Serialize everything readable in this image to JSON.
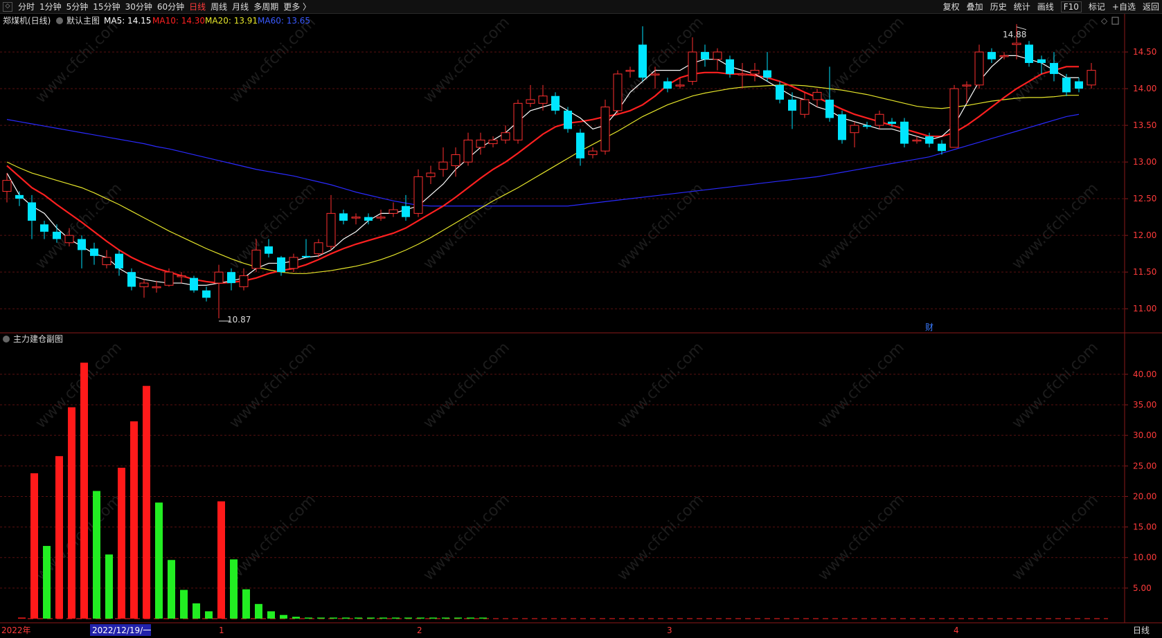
{
  "toolbar": {
    "left_items": [
      "分时",
      "1分钟",
      "5分钟",
      "15分钟",
      "30分钟",
      "60分钟",
      "日线",
      "周线",
      "月线",
      "多周期",
      "更多 〉"
    ],
    "active_item": "日线",
    "right_items": [
      "复权",
      "叠加",
      "历史",
      "统计",
      "画线",
      "F10",
      "标记",
      "+自选",
      "返回"
    ]
  },
  "main_chart": {
    "stock_title": "郑煤机(日线)",
    "template_label": "默认主图",
    "ma5_label": "MA5: 14.15",
    "ma10_label": "MA10: 14.30",
    "ma20_label": "MA20: 13.91",
    "ma60_label": "MA60: 13.65",
    "high_marker": "14.88",
    "low_marker": "10.87",
    "finance_marker": "财",
    "colors": {
      "up": "#ff3030",
      "down": "#00e5ff",
      "ma5": "#ffffff",
      "ma10": "#ff2020",
      "ma20": "#e6e62a",
      "ma60": "#2a2aff"
    }
  },
  "sub_chart": {
    "title": "主力建仓副图"
  },
  "x_axis": {
    "labels": [
      "2022年",
      "1",
      "2",
      "3",
      "4"
    ],
    "cursor_label": "2022/12/19/一",
    "period_label": "日线"
  },
  "watermark": "www.cfchi.com",
  "chart_data": [
    {
      "type": "candlestick",
      "title": "郑煤机(日线)",
      "ylim": [
        10.7,
        14.85
      ],
      "y_ticks": [
        "14.50",
        "14.00",
        "13.50",
        "13.00",
        "12.50",
        "12.00",
        "11.50",
        "11.00"
      ],
      "candles": [
        [
          12.6,
          12.75,
          12.85,
          12.45
        ],
        [
          12.55,
          12.5,
          12.6,
          12.4
        ],
        [
          12.45,
          12.2,
          12.55,
          11.95
        ],
        [
          12.15,
          12.05,
          12.2,
          11.95
        ],
        [
          12.05,
          11.95,
          12.15,
          11.9
        ],
        [
          11.9,
          12.0,
          12.1,
          11.85
        ],
        [
          11.95,
          11.8,
          12.0,
          11.55
        ],
        [
          11.82,
          11.72,
          11.9,
          11.6
        ],
        [
          11.6,
          11.7,
          11.8,
          11.55
        ],
        [
          11.75,
          11.55,
          11.8,
          11.45
        ],
        [
          11.5,
          11.3,
          11.55,
          11.25
        ],
        [
          11.3,
          11.35,
          11.4,
          11.15
        ],
        [
          11.3,
          11.3,
          11.38,
          11.22
        ],
        [
          11.32,
          11.5,
          11.55,
          11.3
        ],
        [
          11.45,
          11.45,
          11.5,
          11.35
        ],
        [
          11.42,
          11.25,
          11.45,
          11.22
        ],
        [
          11.25,
          11.15,
          11.3,
          11.1
        ],
        [
          11.35,
          11.5,
          11.6,
          10.87
        ],
        [
          11.5,
          11.35,
          11.55,
          11.25
        ],
        [
          11.3,
          11.45,
          11.55,
          11.25
        ],
        [
          11.55,
          11.8,
          11.95,
          11.5
        ],
        [
          11.85,
          11.75,
          11.95,
          11.7
        ],
        [
          11.7,
          11.5,
          11.72,
          11.45
        ],
        [
          11.55,
          11.7,
          11.75,
          11.5
        ],
        [
          11.72,
          11.7,
          11.95,
          11.7
        ],
        [
          11.75,
          11.9,
          11.95,
          11.7
        ],
        [
          11.85,
          12.3,
          12.55,
          11.8
        ],
        [
          12.3,
          12.2,
          12.35,
          12.15
        ],
        [
          12.25,
          12.25,
          12.3,
          12.15
        ],
        [
          12.25,
          12.2,
          12.3,
          12.15
        ],
        [
          12.25,
          12.25,
          12.35,
          12.2
        ],
        [
          12.3,
          12.35,
          12.45,
          12.25
        ],
        [
          12.4,
          12.25,
          12.55,
          12.2
        ],
        [
          12.3,
          12.8,
          12.9,
          12.25
        ],
        [
          12.8,
          12.85,
          12.95,
          12.7
        ],
        [
          12.9,
          13.0,
          13.2,
          12.8
        ],
        [
          12.95,
          13.1,
          13.2,
          12.8
        ],
        [
          13.0,
          13.3,
          13.4,
          12.95
        ],
        [
          13.2,
          13.3,
          13.4,
          13.1
        ],
        [
          13.25,
          13.3,
          13.35,
          13.2
        ],
        [
          13.3,
          13.4,
          13.5,
          13.25
        ],
        [
          13.3,
          13.8,
          13.85,
          13.25
        ],
        [
          13.8,
          13.85,
          14.05,
          13.75
        ],
        [
          13.8,
          13.9,
          14.05,
          13.7
        ],
        [
          13.9,
          13.7,
          13.95,
          13.65
        ],
        [
          13.7,
          13.45,
          13.75,
          13.4
        ],
        [
          13.4,
          13.05,
          13.45,
          12.95
        ],
        [
          13.1,
          13.15,
          13.2,
          13.05
        ],
        [
          13.15,
          13.75,
          13.85,
          13.1
        ],
        [
          13.7,
          14.2,
          14.25,
          13.65
        ],
        [
          14.25,
          14.25,
          14.3,
          14.15
        ],
        [
          14.6,
          14.15,
          14.85,
          14.1
        ],
        [
          14.2,
          14.2,
          14.3,
          14.0
        ],
        [
          14.1,
          14.0,
          14.15,
          13.95
        ],
        [
          14.05,
          14.05,
          14.15,
          14.0
        ],
        [
          14.1,
          14.5,
          14.7,
          14.05
        ],
        [
          14.5,
          14.4,
          14.6,
          14.3
        ],
        [
          14.4,
          14.5,
          14.55,
          14.25
        ],
        [
          14.4,
          14.2,
          14.45,
          14.15
        ],
        [
          14.2,
          14.2,
          14.35,
          14.0
        ],
        [
          14.2,
          14.25,
          14.35,
          14.1
        ],
        [
          14.25,
          14.15,
          14.5,
          14.1
        ],
        [
          14.05,
          13.85,
          14.1,
          13.8
        ],
        [
          13.85,
          13.7,
          13.95,
          13.45
        ],
        [
          13.65,
          13.85,
          13.95,
          13.6
        ],
        [
          13.85,
          13.95,
          14.0,
          13.75
        ],
        [
          13.85,
          13.6,
          14.3,
          13.55
        ],
        [
          13.65,
          13.3,
          13.7,
          13.25
        ],
        [
          13.4,
          13.5,
          13.55,
          13.2
        ],
        [
          13.5,
          13.48,
          13.55,
          13.45
        ],
        [
          13.5,
          13.65,
          13.7,
          13.45
        ],
        [
          13.55,
          13.52,
          13.6,
          13.48
        ],
        [
          13.55,
          13.25,
          13.6,
          13.2
        ],
        [
          13.3,
          13.3,
          13.35,
          13.25
        ],
        [
          13.35,
          13.25,
          13.4,
          13.2
        ],
        [
          13.25,
          13.15,
          13.3,
          13.1
        ],
        [
          13.2,
          14.0,
          14.05,
          13.2
        ],
        [
          14.05,
          14.05,
          14.1,
          13.8
        ],
        [
          14.05,
          14.5,
          14.6,
          14.0
        ],
        [
          14.5,
          14.4,
          14.55,
          14.35
        ],
        [
          14.45,
          14.45,
          14.5,
          14.4
        ],
        [
          14.6,
          14.62,
          14.88,
          14.4
        ],
        [
          14.6,
          14.35,
          14.65,
          14.3
        ],
        [
          14.4,
          14.35,
          14.45,
          14.2
        ],
        [
          14.35,
          14.2,
          14.5,
          14.1
        ],
        [
          14.15,
          13.95,
          14.2,
          13.9
        ],
        [
          14.1,
          14.0,
          14.15,
          13.95
        ],
        [
          14.05,
          14.25,
          14.35,
          14.0
        ]
      ],
      "ma5": [
        12.85,
        12.55,
        12.4,
        12.3,
        12.1,
        11.95,
        11.85,
        11.75,
        11.7,
        11.55,
        11.45,
        11.4,
        11.37,
        11.35,
        11.35,
        11.32,
        11.32,
        11.35,
        11.38,
        11.42,
        11.55,
        11.62,
        11.62,
        11.65,
        11.7,
        11.72,
        11.8,
        11.95,
        12.05,
        12.2,
        12.3,
        12.3,
        12.35,
        12.4,
        12.55,
        12.7,
        12.9,
        13.05,
        13.2,
        13.3,
        13.4,
        13.55,
        13.7,
        13.75,
        13.8,
        13.7,
        13.6,
        13.45,
        13.5,
        13.7,
        13.95,
        14.1,
        14.25,
        14.25,
        14.25,
        14.35,
        14.4,
        14.4,
        14.3,
        14.25,
        14.2,
        14.1,
        14.0,
        13.9,
        13.85,
        13.75,
        13.7,
        13.6,
        13.55,
        13.5,
        13.45,
        13.45,
        13.4,
        13.35,
        13.3,
        13.35,
        13.5,
        13.8,
        14.1,
        14.3,
        14.45,
        14.45,
        14.4,
        14.35,
        14.25,
        14.15,
        14.15
      ],
      "ma10": [
        12.95,
        12.8,
        12.65,
        12.55,
        12.42,
        12.3,
        12.18,
        12.05,
        11.92,
        11.8,
        11.7,
        11.62,
        11.55,
        11.5,
        11.45,
        11.4,
        11.37,
        11.35,
        11.36,
        11.38,
        11.42,
        11.48,
        11.52,
        11.55,
        11.6,
        11.67,
        11.75,
        11.82,
        11.88,
        11.93,
        11.98,
        12.03,
        12.1,
        12.2,
        12.3,
        12.4,
        12.52,
        12.65,
        12.78,
        12.9,
        13.0,
        13.12,
        13.25,
        13.38,
        13.48,
        13.53,
        13.55,
        13.58,
        13.62,
        13.65,
        13.7,
        13.78,
        13.9,
        14.05,
        14.15,
        14.2,
        14.22,
        14.22,
        14.2,
        14.2,
        14.18,
        14.15,
        14.1,
        14.03,
        13.95,
        13.88,
        13.8,
        13.72,
        13.65,
        13.6,
        13.55,
        13.5,
        13.45,
        13.4,
        13.35,
        13.35,
        13.4,
        13.5,
        13.62,
        13.75,
        13.88,
        14.0,
        14.1,
        14.2,
        14.25,
        14.3,
        14.3
      ],
      "ma20": [
        13.0,
        12.92,
        12.85,
        12.8,
        12.75,
        12.7,
        12.65,
        12.58,
        12.5,
        12.42,
        12.33,
        12.24,
        12.15,
        12.06,
        11.98,
        11.9,
        11.82,
        11.75,
        11.68,
        11.62,
        11.57,
        11.53,
        11.5,
        11.48,
        11.48,
        11.5,
        11.52,
        11.55,
        11.58,
        11.62,
        11.67,
        11.73,
        11.8,
        11.88,
        11.97,
        12.07,
        12.17,
        12.27,
        12.37,
        12.47,
        12.56,
        12.65,
        12.75,
        12.85,
        12.95,
        13.05,
        13.15,
        13.24,
        13.33,
        13.42,
        13.52,
        13.62,
        13.7,
        13.78,
        13.84,
        13.9,
        13.94,
        13.97,
        14.0,
        14.02,
        14.03,
        14.04,
        14.05,
        14.05,
        14.04,
        14.02,
        14.0,
        13.98,
        13.95,
        13.92,
        13.88,
        13.84,
        13.8,
        13.76,
        13.74,
        13.73,
        13.75,
        13.77,
        13.8,
        13.83,
        13.85,
        13.87,
        13.88,
        13.88,
        13.89,
        13.91,
        13.91
      ],
      "ma60": [
        13.58,
        13.55,
        13.52,
        13.49,
        13.46,
        13.43,
        13.4,
        13.37,
        13.34,
        13.31,
        13.28,
        13.25,
        13.21,
        13.18,
        13.14,
        13.1,
        13.06,
        13.02,
        12.98,
        12.94,
        12.9,
        12.87,
        12.84,
        12.81,
        12.77,
        12.73,
        12.69,
        12.64,
        12.59,
        12.55,
        12.51,
        12.47,
        12.44,
        12.41,
        12.4,
        12.4,
        12.4,
        12.4,
        12.4,
        12.4,
        12.4,
        12.4,
        12.4,
        12.4,
        12.4,
        12.4,
        12.42,
        12.44,
        12.46,
        12.48,
        12.5,
        12.52,
        12.54,
        12.56,
        12.58,
        12.6,
        12.62,
        12.64,
        12.66,
        12.68,
        12.7,
        12.72,
        12.74,
        12.76,
        12.78,
        12.8,
        12.83,
        12.86,
        12.89,
        12.92,
        12.95,
        12.98,
        13.01,
        13.04,
        13.07,
        13.12,
        13.17,
        13.22,
        13.27,
        13.32,
        13.37,
        13.42,
        13.47,
        13.52,
        13.57,
        13.62,
        13.65
      ]
    },
    {
      "type": "bar",
      "title": "主力建仓副图",
      "ylim": [
        0,
        43.5
      ],
      "y_ticks": [
        "40.00",
        "35.00",
        "30.00",
        "25.00",
        "20.00",
        "15.00",
        "10.00",
        "5.00"
      ],
      "values": [
        0,
        23.8,
        11.9,
        26.6,
        34.6,
        41.9,
        20.9,
        10.5,
        24.7,
        32.3,
        38.1,
        19.0,
        9.6,
        4.7,
        2.5,
        1.2,
        19.2,
        9.7,
        4.8,
        2.4,
        1.2,
        0.6,
        0.3,
        0.15,
        0.08,
        0.04,
        0.02,
        0.01,
        0.01,
        0.01,
        0.01,
        0.01,
        0.01,
        0.01,
        0.01,
        0.01,
        0.01,
        0.01
      ],
      "colors": [
        "red",
        "red",
        "green",
        "red",
        "red",
        "red",
        "green",
        "green",
        "red",
        "red",
        "red",
        "green",
        "green",
        "green",
        "green",
        "green",
        "red",
        "green",
        "green",
        "green",
        "green",
        "green",
        "green",
        "green",
        "green",
        "green",
        "green",
        "green",
        "green",
        "green",
        "green",
        "green",
        "green",
        "green",
        "green",
        "green",
        "green",
        "green"
      ]
    }
  ]
}
